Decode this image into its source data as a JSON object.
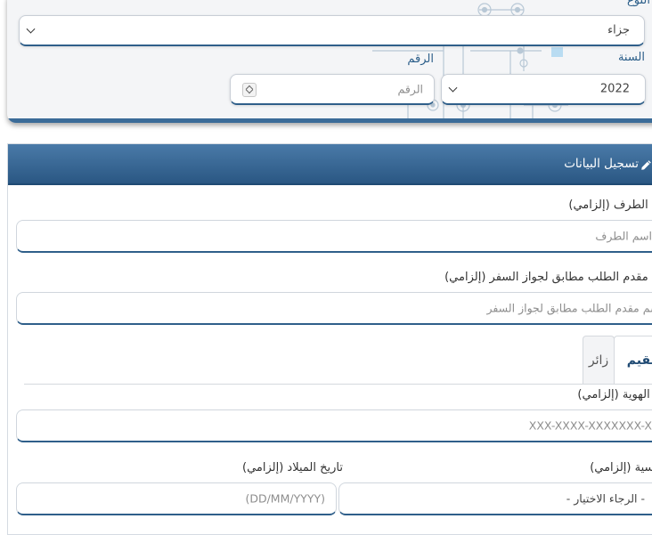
{
  "search_panel": {
    "type_label": "النوع",
    "type_value": "جزاء",
    "year_label": "السنة",
    "year_value": "2022",
    "number_label": "الرقم",
    "number_placeholder": "الرقم"
  },
  "card": {
    "title": "تسجيل البيانات",
    "party_name_label": "اسم الطرف (إلزامي)",
    "party_name_placeholder": "اسم الطرف",
    "applicant_name_label": "اسم مقدم الطلب مطابق لجواز السفر (إلزامي)",
    "applicant_name_placeholder": "اسم مقدم الطلب مطابق لجواز السفر",
    "tabs": [
      {
        "label": "مقيم",
        "active": true
      },
      {
        "label": "زائر",
        "active": false
      }
    ],
    "id_number_label": "رقم الهوية (إلزامي)",
    "id_number_placeholder": "XXX-XXXX-XXXXXXX-X",
    "nationality_label": "الجنسية (إلزامي)",
    "nationality_value": "- الرجاء الاختيار -",
    "birth_date_label": "تاريخ الميلاد (إلزامي)",
    "birth_date_placeholder": "(DD/MM/YYYY)"
  },
  "icons": {
    "edit": "pencil-icon",
    "dropdown": "chevron-down-icon",
    "spinner": "number-spinner-icon"
  },
  "colors": {
    "accent": "#2f5f8a",
    "header_top": "#4a7aa8",
    "header_bottom": "#2a5783",
    "label_blue": "#2c5f8a"
  }
}
